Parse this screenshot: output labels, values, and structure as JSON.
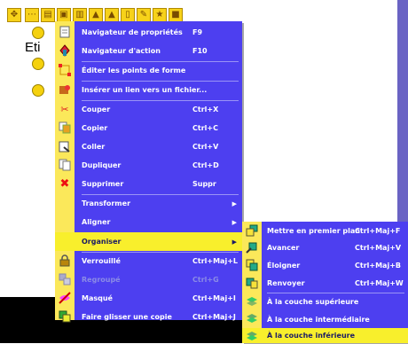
{
  "toolbar": {
    "icons": [
      "select-icon",
      "dash-icon",
      "form-icon",
      "image-icon",
      "chart-icon",
      "landscape-icon",
      "page-icon",
      "action-icon",
      "star-icon",
      "color-icon"
    ]
  },
  "canvas": {
    "label": "Eti"
  },
  "context_menu": {
    "items": [
      {
        "label": "Navigateur de propriétés",
        "shortcut": "F9",
        "icon": "page-icon"
      },
      {
        "label": "Navigateur d'action",
        "shortcut": "F10",
        "icon": "action-icon"
      },
      {
        "label": "Éditer les points de forme",
        "shortcut": "",
        "icon": "shape-points-icon"
      },
      {
        "label": "Insérer un lien vers un fichier...",
        "shortcut": "",
        "icon": "link-icon"
      },
      {
        "label": "Couper",
        "shortcut": "Ctrl+X",
        "icon": "scissors-icon"
      },
      {
        "label": "Copier",
        "shortcut": "Ctrl+C",
        "icon": "copy-icon"
      },
      {
        "label": "Coller",
        "shortcut": "Ctrl+V",
        "icon": "paste-icon"
      },
      {
        "label": "Dupliquer",
        "shortcut": "Ctrl+D",
        "icon": "duplicate-icon"
      },
      {
        "label": "Supprimer",
        "shortcut": "Suppr",
        "icon": "delete-icon"
      },
      {
        "label": "Transformer",
        "shortcut": "",
        "icon": "",
        "submenu": true
      },
      {
        "label": "Aligner",
        "shortcut": "",
        "icon": "",
        "submenu": true
      },
      {
        "label": "Organiser",
        "shortcut": "",
        "icon": "",
        "submenu": true,
        "highlighted": true
      },
      {
        "label": "Verrouillé",
        "shortcut": "Ctrl+Maj+L",
        "icon": "lock-icon"
      },
      {
        "label": "Regroupé",
        "shortcut": "Ctrl+G",
        "icon": "group-icon",
        "disabled": true
      },
      {
        "label": "Masqué",
        "shortcut": "Ctrl+Maj+I",
        "icon": "hidden-icon"
      },
      {
        "label": "Faire glisser une copie",
        "shortcut": "Ctrl+Maj+J",
        "icon": "drag-copy-icon"
      }
    ]
  },
  "organiser_submenu": {
    "items": [
      {
        "label": "Mettre en premier plan",
        "shortcut": "Ctrl+Maj+F"
      },
      {
        "label": "Avancer",
        "shortcut": "Ctrl+Maj+V"
      },
      {
        "label": "Éloigner",
        "shortcut": "Ctrl+Maj+B"
      },
      {
        "label": "Renvoyer",
        "shortcut": "Ctrl+Maj+W"
      },
      {
        "label": "À la couche supérieure",
        "shortcut": ""
      },
      {
        "label": "À la couche intermédiaire",
        "shortcut": ""
      },
      {
        "label": "À la couche inférieure",
        "shortcut": "",
        "highlighted": true
      }
    ]
  }
}
